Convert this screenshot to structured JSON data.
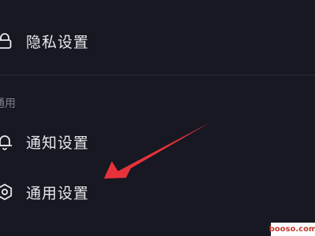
{
  "settings": {
    "privacy": {
      "label": "隐私设置",
      "icon": "lock-icon"
    },
    "section_header": "通用",
    "notifications": {
      "label": "通知设置",
      "icon": "bell-icon"
    },
    "general": {
      "label": "通用设置",
      "icon": "gear-icon"
    }
  },
  "annotation": {
    "type": "arrow",
    "color": "#e8323a",
    "points_to": "general"
  },
  "watermark": "booso.com",
  "colors": {
    "background": "#171822",
    "text": "#e9e9ec",
    "section_text": "#7e7f88",
    "divider": "#2a2b35",
    "arrow": "#e8323a"
  }
}
